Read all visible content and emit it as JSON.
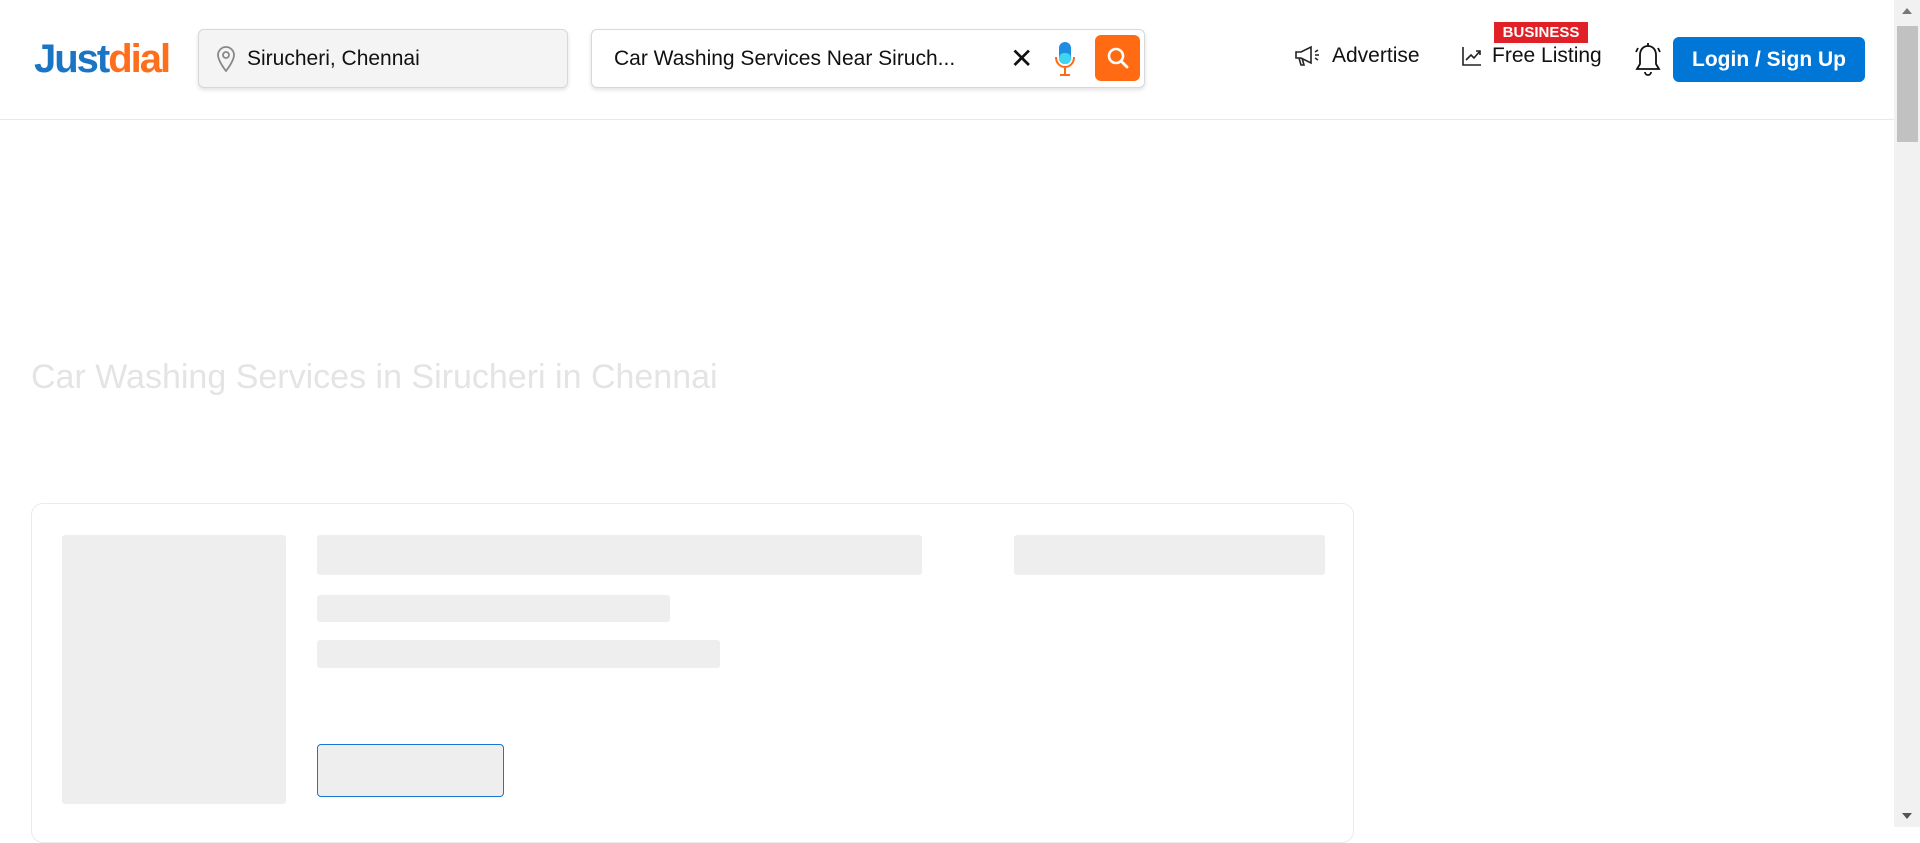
{
  "header": {
    "logo": {
      "part1": "Just",
      "part2": "dial"
    },
    "location": "Sirucheri, Chennai",
    "search_query": "Car Washing Services Near Siruch...",
    "nav": {
      "advertise": "Advertise",
      "free_listing": "Free Listing",
      "business_badge": "BUSINESS",
      "login": "Login / Sign Up"
    }
  },
  "main": {
    "heading": "Car Washing Services in Sirucheri in Chennai"
  },
  "colors": {
    "brand_blue": "#0076d7",
    "brand_orange": "#ff6a13",
    "badge_red": "#e02127"
  }
}
